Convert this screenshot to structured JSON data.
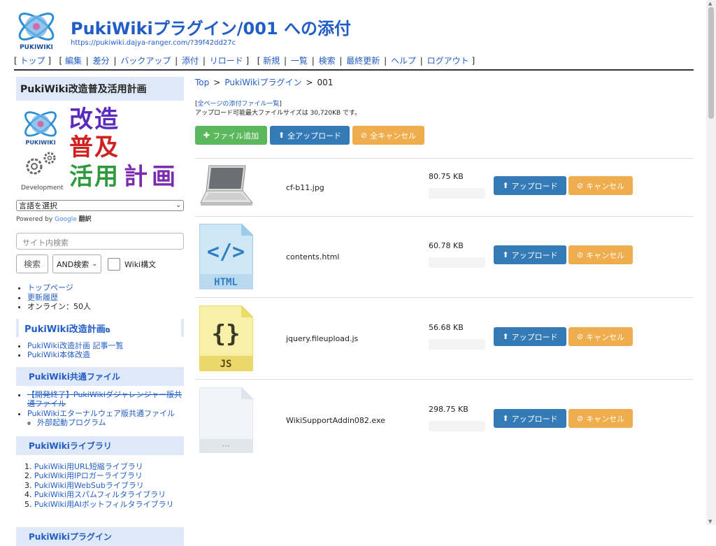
{
  "header": {
    "title": "PukiWikiプラグイン/001 への添付",
    "url": "https://pukiwiki.dajya-ranger.com/?39f42dd27c",
    "logo_text": "PUKIWIKI"
  },
  "navigator": {
    "group1": [
      "トップ"
    ],
    "group2": [
      "編集",
      "差分",
      "バックアップ",
      "添付",
      "リロード"
    ],
    "group3": [
      "新規",
      "一覧",
      "検索",
      "最終更新",
      "ヘルプ",
      "ログアウト"
    ]
  },
  "sidebar": {
    "site_title": "PukiWiki改造普及活用計画",
    "banner": {
      "chars": [
        "改",
        "造",
        "普",
        "及",
        "活",
        "用",
        "計",
        "画"
      ],
      "development": "Development",
      "logo_text": "PUKIWIKI"
    },
    "language_select": "言語を選択",
    "powered_by": "Powered by",
    "google": "Google",
    "translate": "翻訳",
    "search_placeholder": "サイト内検索",
    "search_button": "検索",
    "search_mode": "AND検索",
    "wiki_syntax_label": "Wiki構文",
    "links": [
      "トップページ",
      "更新履歴"
    ],
    "online": "オンライン：50人",
    "section1": {
      "title": "PukiWiki改造計画",
      "items": [
        "PukiWiki改造計画 記事一覧",
        "PukiWiki本体改造"
      ]
    },
    "section2": {
      "title": "PukiWiki共通ファイル",
      "items": [
        "【開発終了】PukiWikiダジャレンジャー版共通ファイル",
        "PukiWikiエターナルウェア版共通ファイル"
      ],
      "subitems": [
        "外部起動プログラム"
      ]
    },
    "section3": {
      "title": "PukiWikiライブラリ",
      "items": [
        "PukiWiki用URL短縮ライブラリ",
        "PukiWiki用IPロガーライブラリ",
        "PukiWiki用WebSubライブラリ",
        "PukiWiki用スパムフィルタライブラリ",
        "PukiWiki用AIボットフィルタライブラリ"
      ]
    },
    "section4": {
      "title": "PukiWikiプラグイン"
    }
  },
  "main": {
    "breadcrumb": [
      "Top",
      "PukiWikiプラグイン",
      "001"
    ],
    "all_files_link": "全ページの添付ファイル一覧",
    "max_size_text": "アップロード可能最大ファイルサイズは 30,720KB です。",
    "toolbar": {
      "add_file": "ファイル追加",
      "upload_all": "全アップロード",
      "cancel_all": "全キャンセル"
    },
    "upload_label": "アップロード",
    "cancel_label": "キャンセル",
    "files": [
      {
        "name": "cf-b11.jpg",
        "size": "80.75 KB",
        "icon": "laptop-thumbnail",
        "progress": 0
      },
      {
        "name": "contents.html",
        "size": "60.78 KB",
        "icon": "html-file-icon",
        "progress": 0
      },
      {
        "name": "jquery.fileupload.js",
        "size": "56.68 KB",
        "icon": "js-file-icon",
        "progress": 0
      },
      {
        "name": "WikiSupportAddin082.exe",
        "size": "298.75 KB",
        "icon": "generic-file-icon",
        "progress": 0
      }
    ],
    "file_type_labels": {
      "html": "HTML",
      "js": "JS"
    }
  },
  "colors": {
    "link": "#215dc6",
    "green": "#5cb85c",
    "blue": "#337ab7",
    "orange": "#f0ad4e",
    "side_bg": "#dfe8f6"
  }
}
